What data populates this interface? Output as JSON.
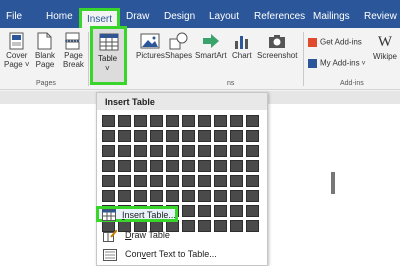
{
  "tabs": [
    {
      "label": "File"
    },
    {
      "label": "Home"
    },
    {
      "label": "Insert",
      "active": true
    },
    {
      "label": "Draw"
    },
    {
      "label": "Design"
    },
    {
      "label": "Layout"
    },
    {
      "label": "References"
    },
    {
      "label": "Mailings"
    },
    {
      "label": "Review"
    }
  ],
  "ribbon": {
    "pages_group": {
      "label": "Pages",
      "buttons": [
        {
          "line1": "Cover",
          "line2": "Page ˅",
          "icon": "cover-page-icon"
        },
        {
          "line1": "Blank",
          "line2": "Page",
          "icon": "blank-page-icon"
        },
        {
          "line1": "Page",
          "line2": "Break",
          "icon": "page-break-icon"
        }
      ]
    },
    "table_button": {
      "line1": "Table",
      "line2": "˅",
      "icon": "table-icon"
    },
    "illustrations": [
      {
        "label": "Pictures",
        "icon": "pictures-icon"
      },
      {
        "label": "Shapes",
        "icon": "shapes-icon"
      },
      {
        "label": "SmartArt",
        "icon": "smartart-icon"
      },
      {
        "label": "Chart",
        "icon": "chart-icon"
      },
      {
        "label": "Screenshot",
        "icon": "screenshot-icon"
      }
    ],
    "illustrations_partial_label": "ns",
    "addins_group": {
      "label": "Add-ins",
      "get_addins": "Get Add-ins",
      "my_addins": "My Add-ins",
      "wiki_label": "Wikipe"
    }
  },
  "dropdown": {
    "title": "Insert Table",
    "grid_columns": 10,
    "grid_rows": 8,
    "items": [
      {
        "label": "Insert Table...",
        "underline_char": "I",
        "rest": "nsert Table...",
        "icon": "insert-table-icon"
      },
      {
        "label": "Draw Table",
        "underline_char": "D",
        "rest": "raw Table",
        "icon": "draw-table-icon"
      },
      {
        "label": "Convert Text to Table...",
        "underline_char": "v",
        "prefix": "Con",
        "rest": "ert Text to Table...",
        "icon": "convert-text-icon"
      }
    ]
  },
  "colors": {
    "title_bar": "#2b579a",
    "highlight": "#39d52b",
    "grid_cell": "#4a4a4a"
  }
}
